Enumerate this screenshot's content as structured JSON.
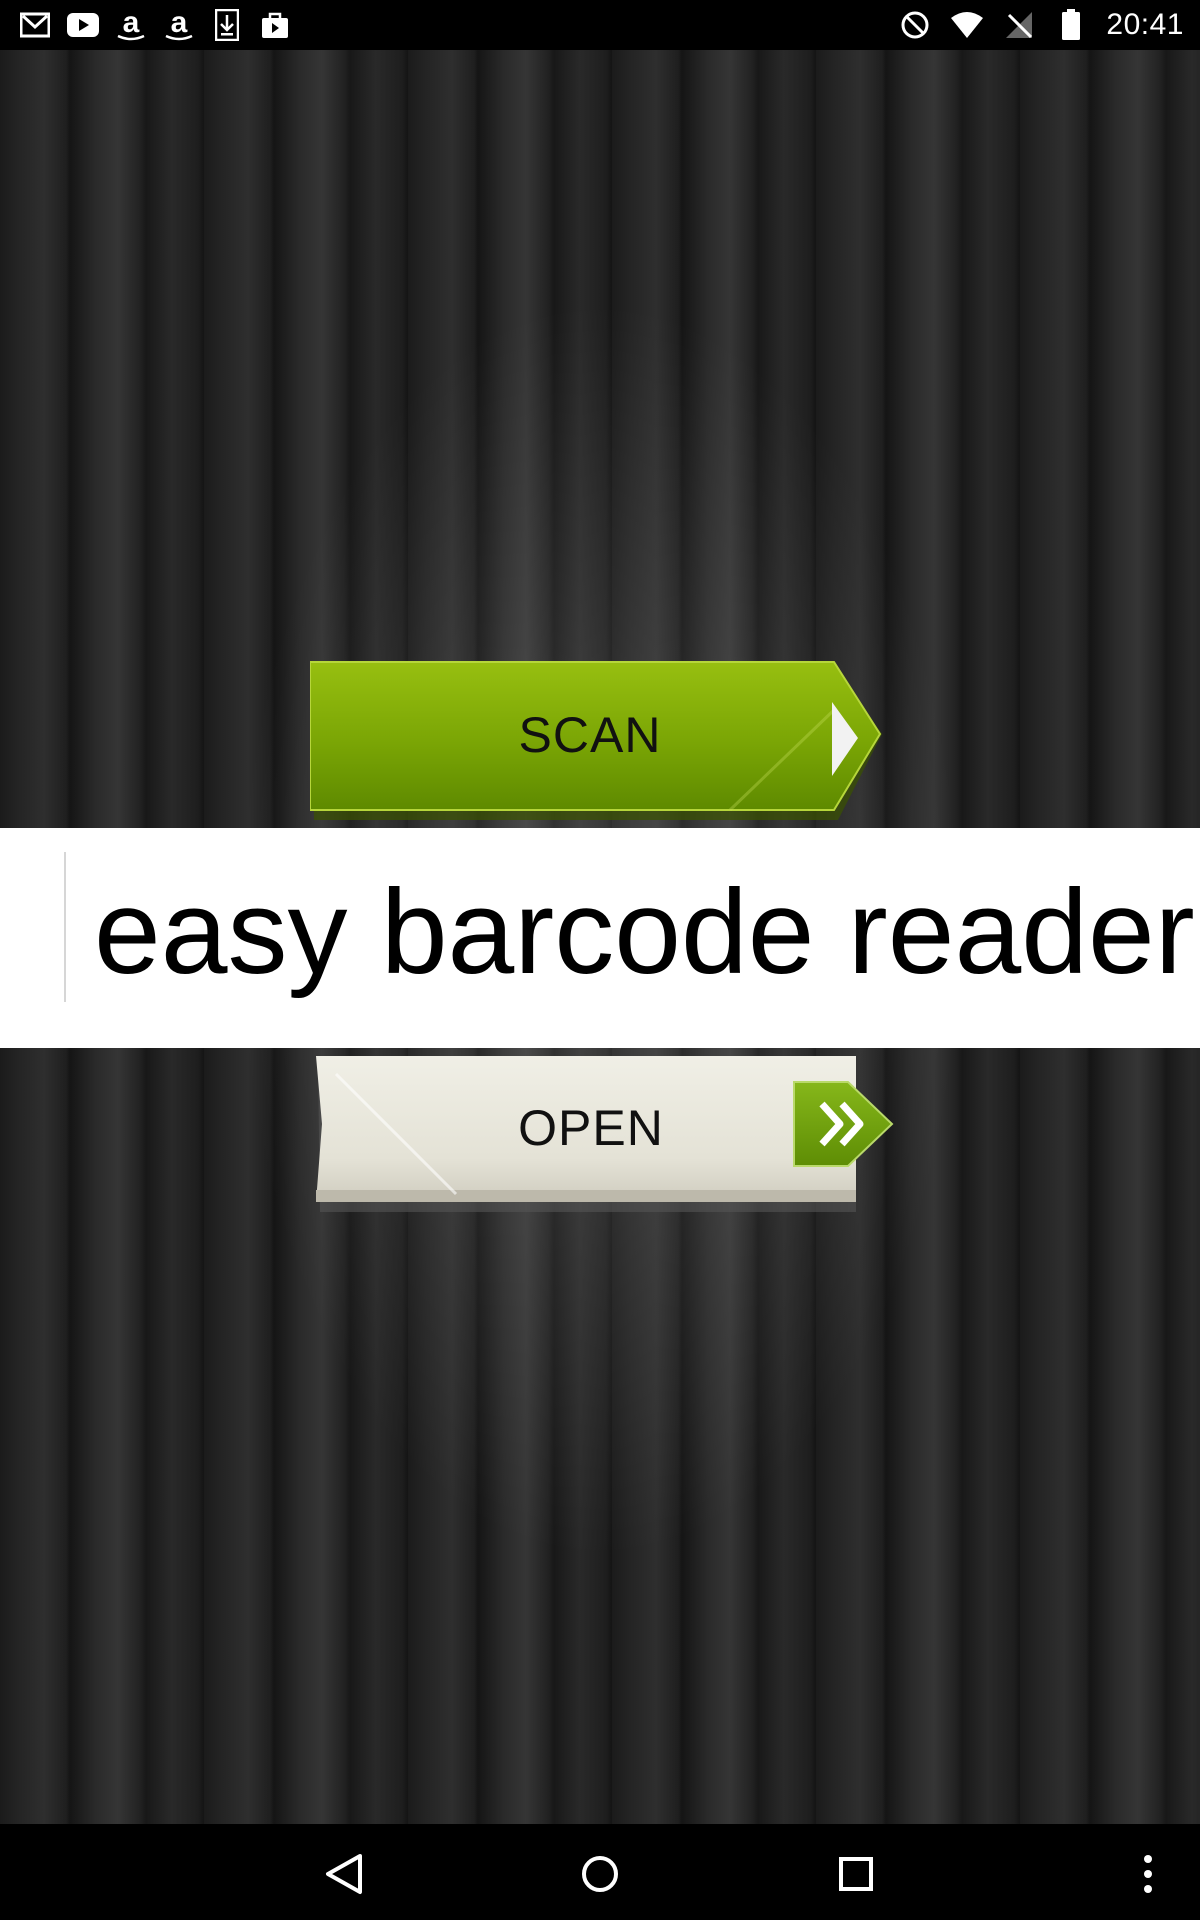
{
  "status_bar": {
    "time": "20:41",
    "left_icons": [
      "gmail-icon",
      "youtube-icon",
      "amazon-icon",
      "amazon-icon",
      "download-icon",
      "shopping-bag-icon"
    ],
    "right_icons": [
      "do-not-disturb-icon",
      "wifi-icon",
      "no-sim-icon",
      "battery-icon"
    ]
  },
  "main": {
    "scan_button": {
      "label": "SCAN",
      "color": "#7da600"
    },
    "title": "easy barcode reader",
    "open_button": {
      "label": "OPEN",
      "accent_color": "#6f9f0c"
    }
  },
  "nav_bar": {
    "buttons": [
      "back-icon",
      "home-icon",
      "recents-icon",
      "overflow-menu-icon"
    ]
  }
}
